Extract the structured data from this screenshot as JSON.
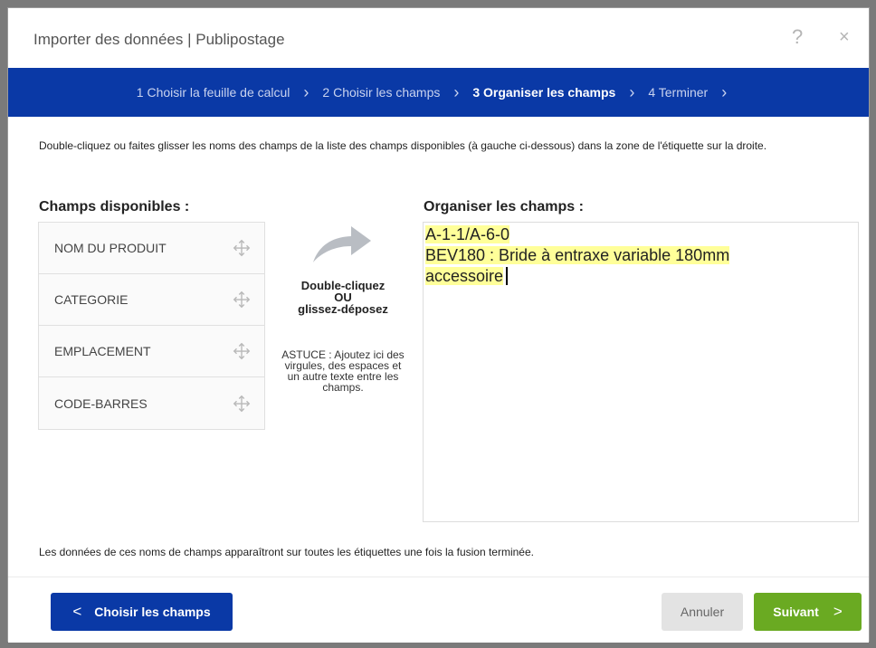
{
  "dialog": {
    "title": "Importer des données | Publipostage",
    "help_label": "?",
    "close_label": "×"
  },
  "steps": [
    {
      "label": "1 Choisir la feuille de calcul",
      "active": false
    },
    {
      "label": "2 Choisir les champs",
      "active": false
    },
    {
      "label": "3 Organiser les champs",
      "active": true
    },
    {
      "label": "4 Terminer",
      "active": false
    }
  ],
  "step_separator": "›",
  "instructions": "Double-cliquez ou faites glisser les noms des champs de la liste des champs disponibles (à gauche ci-dessous) dans la zone de l'étiquette sur la droite.",
  "available": {
    "heading": "Champs disponibles :",
    "fields": [
      "NOM DU PRODUIT",
      "CATEGORIE",
      "EMPLACEMENT",
      "CODE-BARRES"
    ]
  },
  "hint": {
    "line1": "Double-cliquez",
    "line2": "OU",
    "line3": "glissez-déposez",
    "tip": "ASTUCE : Ajoutez ici des virgules, des espaces et un autre texte entre les champs."
  },
  "arrange": {
    "heading": "Organiser les champs :",
    "lines": [
      "A-1-1/A-6-0",
      "BEV180 : Bride à entraxe variable 180mm",
      "accessoire"
    ],
    "highlight_color": "#ffff99"
  },
  "footnote": "Les données de ces noms de champs apparaîtront sur toutes les étiquettes une fois la fusion terminée.",
  "buttons": {
    "back": "Choisir les champs",
    "cancel": "Annuler",
    "next": "Suivant"
  },
  "colors": {
    "accent_blue": "#0a39a6",
    "next_green": "#6aaa22"
  }
}
